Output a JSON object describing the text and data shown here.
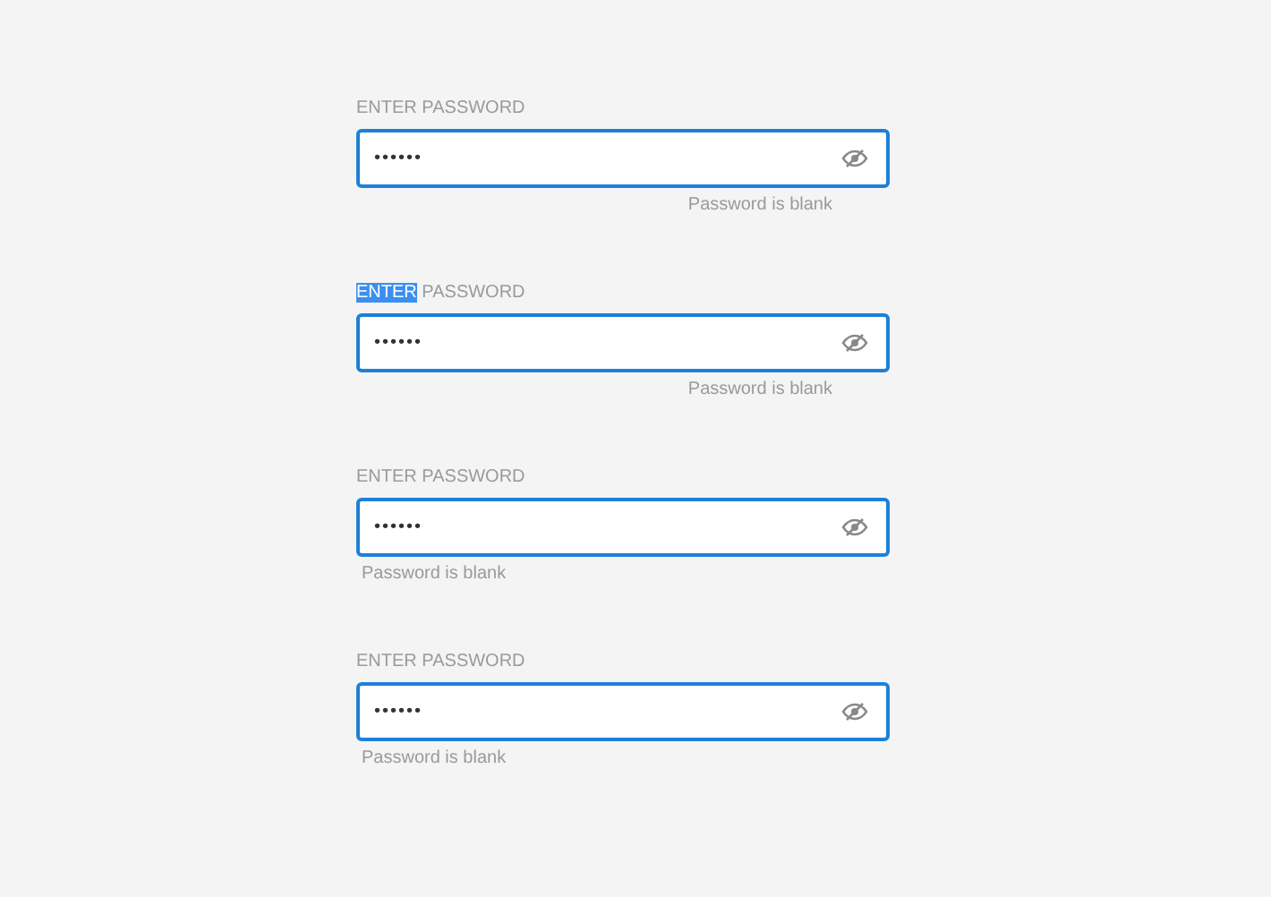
{
  "fields": [
    {
      "kind": "offset",
      "label": [
        {
          "text": "ENTER PASSWORD",
          "selected": false
        }
      ],
      "value": "••••••",
      "error": "Password is blank"
    },
    {
      "kind": "offset",
      "label": [
        {
          "text": "ENTER",
          "selected": true
        },
        {
          "text": " PASSWORD",
          "selected": false
        }
      ],
      "value": "••••••",
      "error": "Password is blank"
    },
    {
      "kind": "below",
      "label": [
        {
          "text": "ENTER PASSWORD",
          "selected": false
        }
      ],
      "value": "••••••",
      "error": "Password is blank"
    },
    {
      "kind": "below",
      "label": [
        {
          "text": "ENTER PASSWORD",
          "selected": false
        }
      ],
      "value": "••••••",
      "error": "Password is blank"
    }
  ]
}
